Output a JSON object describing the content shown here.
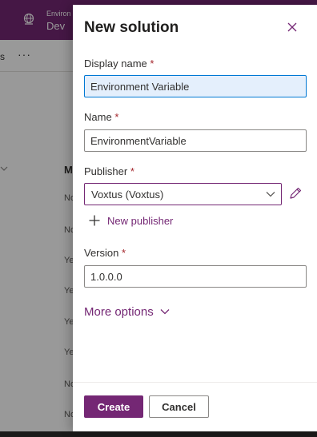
{
  "background": {
    "environment": {
      "label": "Environ",
      "name": "Dev"
    },
    "commandbar": {
      "text": "s",
      "more": "···"
    },
    "grid": {
      "column_header": "M",
      "cells": [
        "No",
        "No",
        "Ye",
        "Ye",
        "Ye",
        "Ye",
        "No",
        "No"
      ]
    }
  },
  "panel": {
    "title": "New solution",
    "close_icon": "close-icon",
    "display_name": {
      "label": "Display name",
      "required": "*",
      "value": "Environment Variable"
    },
    "name": {
      "label": "Name",
      "required": "*",
      "value": "EnvironmentVariable"
    },
    "publisher": {
      "label": "Publisher",
      "required": "*",
      "value": "Voxtus (Voxtus)"
    },
    "new_publisher_label": "New publisher",
    "version": {
      "label": "Version",
      "required": "*",
      "value": "1.0.0.0"
    },
    "more_options_label": "More options",
    "create_label": "Create",
    "cancel_label": "Cancel"
  },
  "colors": {
    "accent": "#742774",
    "required": "#a4262c",
    "active_field_bg": "#e4effc"
  }
}
